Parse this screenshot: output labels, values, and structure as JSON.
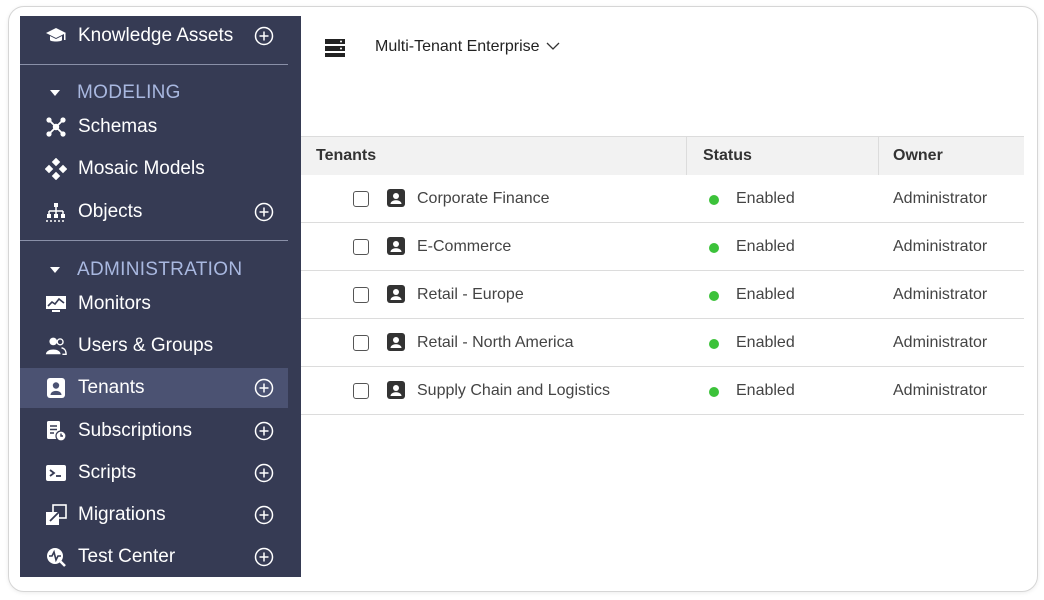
{
  "sidebar": {
    "top_item": {
      "label": "Knowledge Assets",
      "icon": "graduation-cap-icon"
    },
    "sections": [
      {
        "title": "MODELING",
        "items": [
          {
            "label": "Schemas",
            "icon": "schema-network-icon",
            "add": false
          },
          {
            "label": "Mosaic Models",
            "icon": "mosaic-icon",
            "add": false
          },
          {
            "label": "Objects",
            "icon": "objects-hierarchy-icon",
            "add": true
          }
        ]
      },
      {
        "title": "ADMINISTRATION",
        "items": [
          {
            "label": "Monitors",
            "icon": "monitor-chart-icon",
            "add": false
          },
          {
            "label": "Users & Groups",
            "icon": "users-icon",
            "add": false
          },
          {
            "label": "Tenants",
            "icon": "tenant-badge-icon",
            "add": true,
            "active": true
          },
          {
            "label": "Subscriptions",
            "icon": "subscription-icon",
            "add": true
          },
          {
            "label": "Scripts",
            "icon": "terminal-icon",
            "add": true
          },
          {
            "label": "Migrations",
            "icon": "migration-icon",
            "add": true
          },
          {
            "label": "Test Center",
            "icon": "test-center-icon",
            "add": true
          }
        ]
      }
    ]
  },
  "header": {
    "tenant_selector": "Multi-Tenant Enterprise",
    "icon": "server-stack-icon"
  },
  "table": {
    "columns": [
      "Tenants",
      "Status",
      "Owner"
    ],
    "rows": [
      {
        "name": "Corporate Finance",
        "status": "Enabled",
        "owner": "Administrator"
      },
      {
        "name": "E-Commerce",
        "status": "Enabled",
        "owner": "Administrator"
      },
      {
        "name": "Retail - Europe",
        "status": "Enabled",
        "owner": "Administrator"
      },
      {
        "name": "Retail - North America",
        "status": "Enabled",
        "owner": "Administrator"
      },
      {
        "name": "Supply Chain and Logistics",
        "status": "Enabled",
        "owner": "Administrator"
      }
    ]
  },
  "colors": {
    "sidebar_bg": "#363b54",
    "sidebar_active": "#4b5272",
    "section_title": "#a9b8e0",
    "status_enabled": "#3cc23a"
  }
}
